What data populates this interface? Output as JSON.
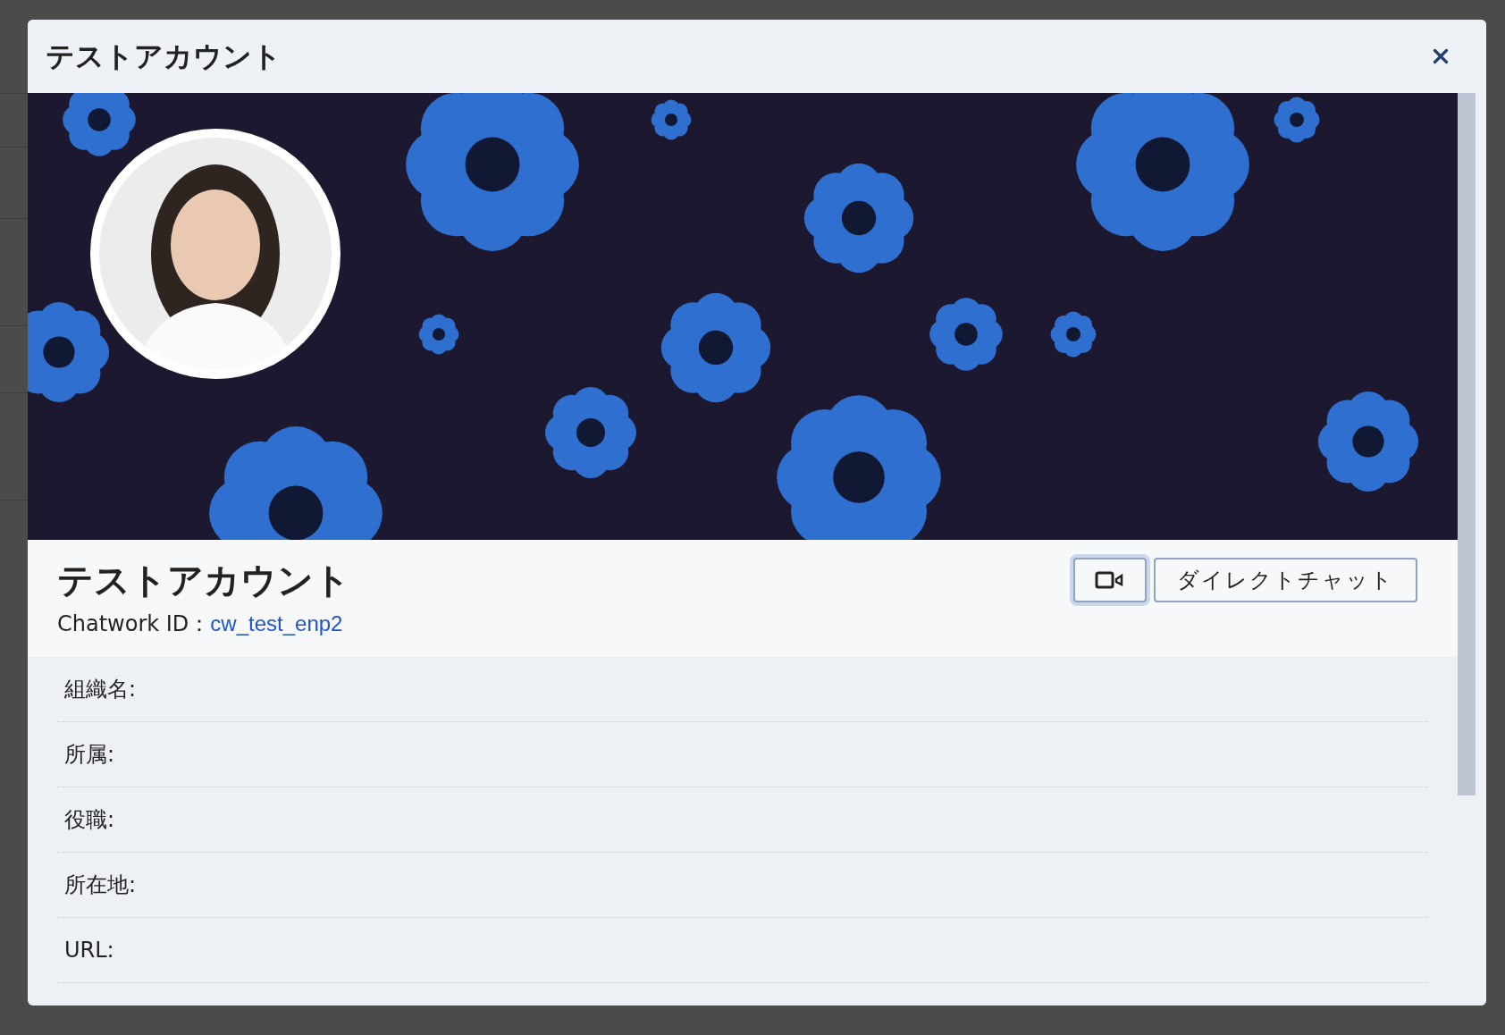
{
  "modal": {
    "title": "テストアカウント"
  },
  "profile": {
    "name": "テストアカウント",
    "id_label": "Chatwork ID：",
    "id_value": "cw_test_enp2"
  },
  "buttons": [
    {
      "kind": "video",
      "focused": true
    },
    {
      "kind": "text",
      "label": "ダイレクトチャット",
      "focused": false
    }
  ],
  "fields": [
    {
      "label": "組織名:"
    },
    {
      "label": "所属:"
    },
    {
      "label": "役職:"
    },
    {
      "label": "所在地:"
    },
    {
      "label": "URL:"
    }
  ]
}
